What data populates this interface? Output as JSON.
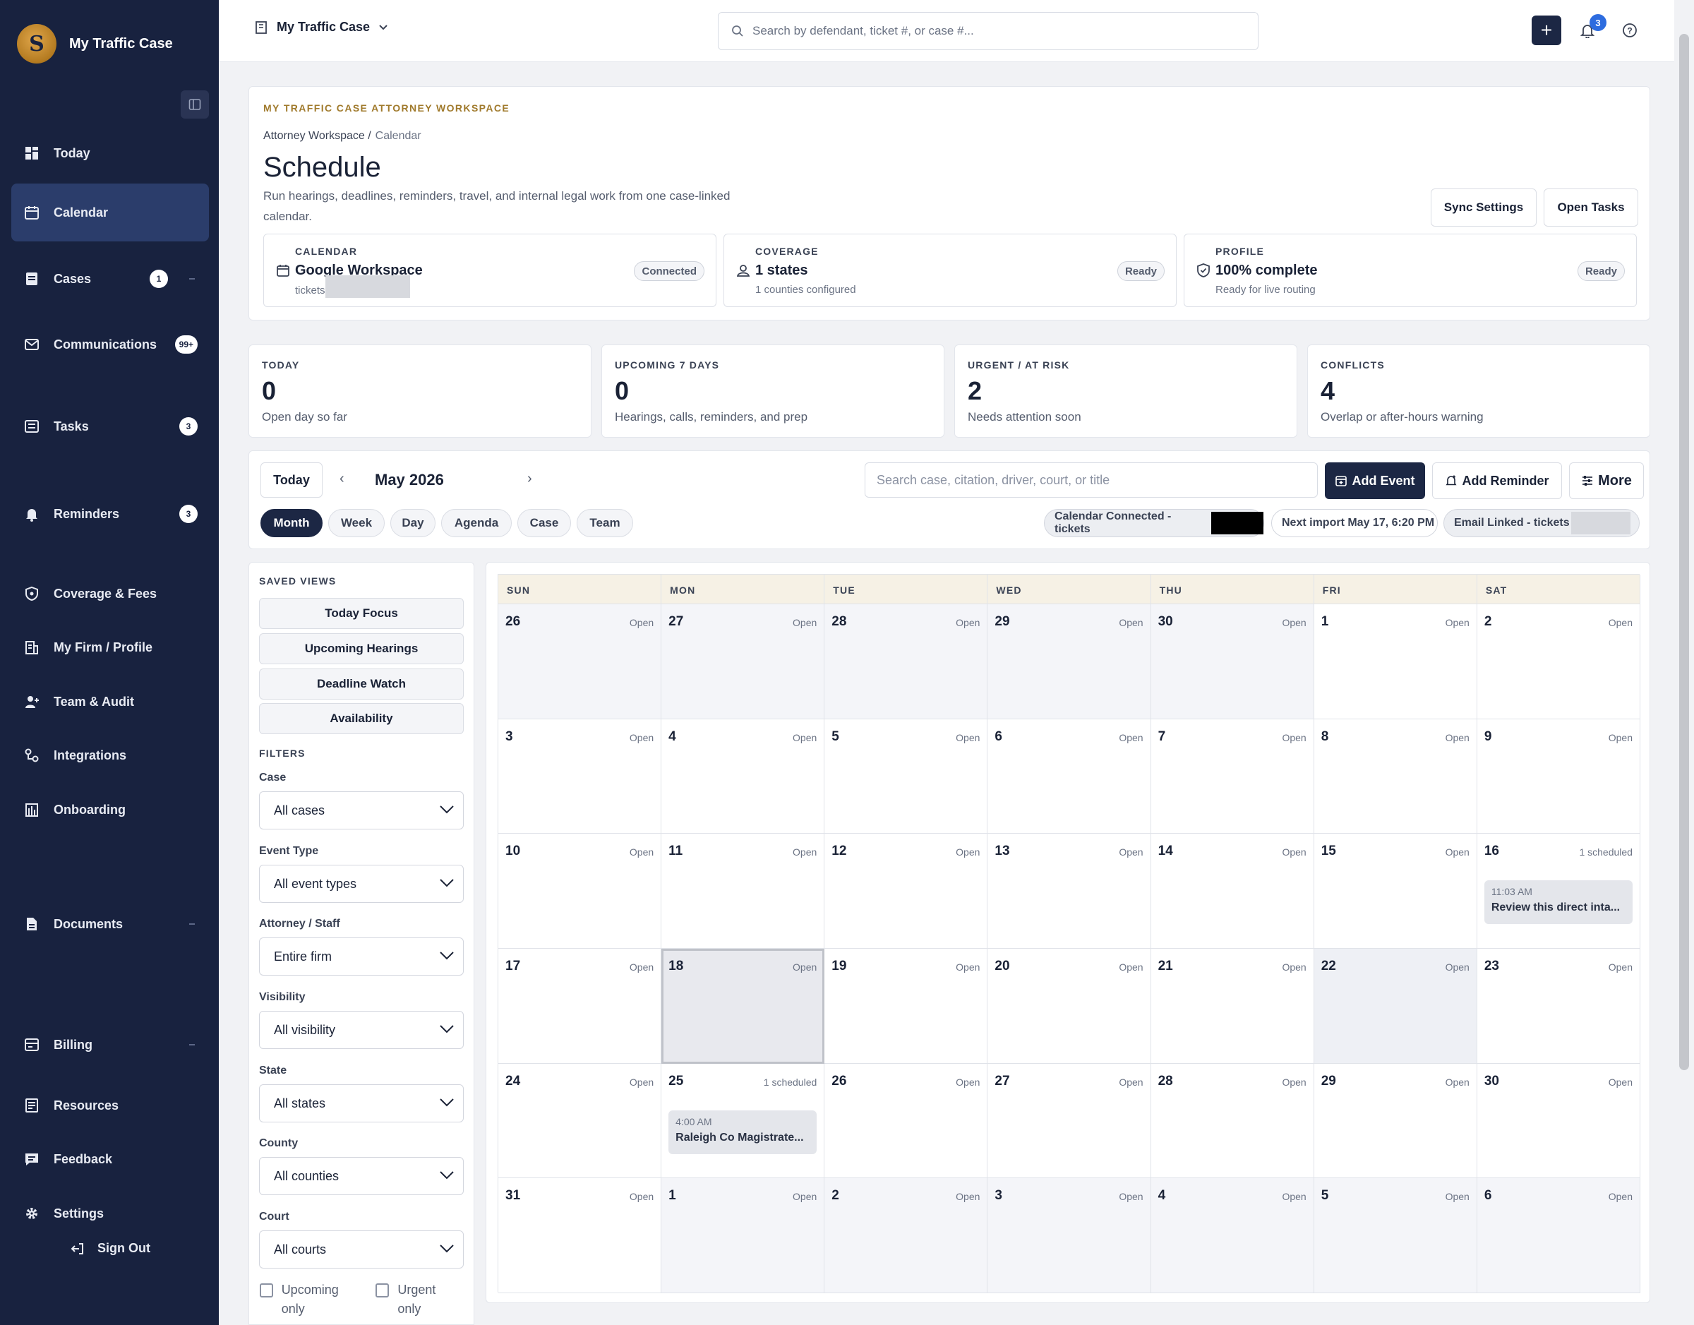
{
  "app": {
    "name": "My Traffic Case"
  },
  "sidebar": {
    "items": [
      {
        "label": "Today",
        "icon": "dashboard-icon",
        "badge": ""
      },
      {
        "label": "Calendar",
        "icon": "calendar-icon",
        "badge": "",
        "active": true
      },
      {
        "label": "Cases",
        "icon": "cases-icon",
        "badge": "1"
      },
      {
        "label": "Communications",
        "icon": "mail-icon",
        "badge": "99+"
      },
      {
        "label": "Tasks",
        "icon": "tasks-icon",
        "badge": "3"
      },
      {
        "label": "Reminders",
        "icon": "bell-icon",
        "badge": "3"
      },
      {
        "label": "Coverage & Fees",
        "icon": "shield-icon",
        "badge": ""
      },
      {
        "label": "My Firm / Profile",
        "icon": "building-icon",
        "badge": ""
      },
      {
        "label": "Team & Audit",
        "icon": "user-plus-icon",
        "badge": ""
      },
      {
        "label": "Integrations",
        "icon": "integrations-icon",
        "badge": ""
      },
      {
        "label": "Onboarding",
        "icon": "onboarding-icon",
        "badge": ""
      },
      {
        "label": "Documents",
        "icon": "document-icon",
        "badge": ""
      },
      {
        "label": "Billing",
        "icon": "billing-icon",
        "badge": ""
      },
      {
        "label": "Resources",
        "icon": "resources-icon",
        "badge": ""
      },
      {
        "label": "Feedback",
        "icon": "feedback-icon",
        "badge": ""
      },
      {
        "label": "Settings",
        "icon": "gear-icon",
        "badge": ""
      }
    ],
    "sign_out": "Sign Out"
  },
  "topbar": {
    "workspace": "My Traffic Case",
    "search_placeholder": "Search by defendant, ticket #, or case #...",
    "notifications_count": "3"
  },
  "header": {
    "eyebrow": "MY TRAFFIC CASE ATTORNEY WORKSPACE",
    "breadcrumb": [
      "Attorney Workspace /",
      "Calendar"
    ],
    "title": "Schedule",
    "subtitle": "Run hearings, deadlines, reminders, travel, and internal legal work from one case-linked calendar.",
    "buttons": {
      "sync": "Sync Settings",
      "tasks": "Open Tasks"
    },
    "status_cards": [
      {
        "label": "CALENDAR",
        "value": "Google Workspace",
        "sub": "tickets",
        "pill": "Connected",
        "icon": "calendar-icon"
      },
      {
        "label": "COVERAGE",
        "value": "1 states",
        "sub": "1 counties configured",
        "pill": "Ready",
        "icon": "user-location-icon"
      },
      {
        "label": "PROFILE",
        "value": "100% complete",
        "sub": "Ready for live routing",
        "pill": "Ready",
        "icon": "shield-check-icon"
      }
    ]
  },
  "stats": [
    {
      "label": "TODAY",
      "value": "0",
      "sub": "Open day so far"
    },
    {
      "label": "UPCOMING 7 DAYS",
      "value": "0",
      "sub": "Hearings, calls, reminders, and prep"
    },
    {
      "label": "URGENT / AT RISK",
      "value": "2",
      "sub": "Needs attention soon"
    },
    {
      "label": "CONFLICTS",
      "value": "4",
      "sub": "Overlap or after-hours warning"
    }
  ],
  "toolbar": {
    "today": "Today",
    "prev": "‹",
    "month": "May 2026",
    "next": "›",
    "search_placeholder": "Search case, citation, driver, court, or title",
    "add_event": "Add Event",
    "add_reminder": "Add Reminder",
    "more": "More",
    "views": [
      "Month",
      "Week",
      "Day",
      "Agenda",
      "Case",
      "Team"
    ],
    "active_view": "Month",
    "calendar_connected": "Calendar Connected - tickets",
    "next_import": "Next import May 17, 6:20 PM",
    "email_linked": "Email Linked - tickets"
  },
  "filters": {
    "saved_views_label": "SAVED VIEWS",
    "saved_views": [
      "Today Focus",
      "Upcoming Hearings",
      "Deadline Watch",
      "Availability"
    ],
    "filters_label": "FILTERS",
    "fields": [
      {
        "label": "Case",
        "value": "All cases"
      },
      {
        "label": "Event Type",
        "value": "All event types"
      },
      {
        "label": "Attorney / Staff",
        "value": "Entire firm"
      },
      {
        "label": "Visibility",
        "value": "All visibility"
      },
      {
        "label": "State",
        "value": "All states"
      },
      {
        "label": "County",
        "value": "All counties"
      },
      {
        "label": "Court",
        "value": "All courts"
      }
    ],
    "checks": [
      "Upcoming only",
      "Urgent only"
    ]
  },
  "calendar": {
    "weekdays": [
      "SUN",
      "MON",
      "TUE",
      "WED",
      "THU",
      "FRI",
      "SAT"
    ],
    "weeks": [
      [
        {
          "d": "26",
          "s": "Open",
          "m": "other"
        },
        {
          "d": "27",
          "s": "Open",
          "m": "other"
        },
        {
          "d": "28",
          "s": "Open",
          "m": "other"
        },
        {
          "d": "29",
          "s": "Open",
          "m": "other"
        },
        {
          "d": "30",
          "s": "Open",
          "m": "other"
        },
        {
          "d": "1",
          "s": "Open",
          "m": "cur"
        },
        {
          "d": "2",
          "s": "Open",
          "m": "cur"
        }
      ],
      [
        {
          "d": "3",
          "s": "Open",
          "m": "cur"
        },
        {
          "d": "4",
          "s": "Open",
          "m": "cur"
        },
        {
          "d": "5",
          "s": "Open",
          "m": "cur"
        },
        {
          "d": "6",
          "s": "Open",
          "m": "cur"
        },
        {
          "d": "7",
          "s": "Open",
          "m": "cur"
        },
        {
          "d": "8",
          "s": "Open",
          "m": "cur"
        },
        {
          "d": "9",
          "s": "Open",
          "m": "cur"
        }
      ],
      [
        {
          "d": "10",
          "s": "Open",
          "m": "cur"
        },
        {
          "d": "11",
          "s": "Open",
          "m": "cur"
        },
        {
          "d": "12",
          "s": "Open",
          "m": "cur"
        },
        {
          "d": "13",
          "s": "Open",
          "m": "cur"
        },
        {
          "d": "14",
          "s": "Open",
          "m": "cur"
        },
        {
          "d": "15",
          "s": "Open",
          "m": "cur"
        },
        {
          "d": "16",
          "s": "1 scheduled",
          "m": "cur",
          "event": {
            "time": "11:03 AM",
            "title": "Review this direct inta..."
          }
        }
      ],
      [
        {
          "d": "17",
          "s": "Open",
          "m": "cur"
        },
        {
          "d": "18",
          "s": "Open",
          "m": "today"
        },
        {
          "d": "19",
          "s": "Open",
          "m": "cur"
        },
        {
          "d": "20",
          "s": "Open",
          "m": "cur"
        },
        {
          "d": "21",
          "s": "Open",
          "m": "cur"
        },
        {
          "d": "22",
          "s": "Open",
          "m": "alt"
        },
        {
          "d": "23",
          "s": "Open",
          "m": "cur"
        }
      ],
      [
        {
          "d": "24",
          "s": "Open",
          "m": "cur"
        },
        {
          "d": "25",
          "s": "1 scheduled",
          "m": "cur",
          "event": {
            "time": "4:00 AM",
            "title": "Raleigh Co Magistrate..."
          }
        },
        {
          "d": "26",
          "s": "Open",
          "m": "cur"
        },
        {
          "d": "27",
          "s": "Open",
          "m": "cur"
        },
        {
          "d": "28",
          "s": "Open",
          "m": "cur"
        },
        {
          "d": "29",
          "s": "Open",
          "m": "cur"
        },
        {
          "d": "30",
          "s": "Open",
          "m": "cur"
        }
      ],
      [
        {
          "d": "31",
          "s": "Open",
          "m": "cur"
        },
        {
          "d": "1",
          "s": "Open",
          "m": "other"
        },
        {
          "d": "2",
          "s": "Open",
          "m": "other"
        },
        {
          "d": "3",
          "s": "Open",
          "m": "other"
        },
        {
          "d": "4",
          "s": "Open",
          "m": "other"
        },
        {
          "d": "5",
          "s": "Open",
          "m": "other"
        },
        {
          "d": "6",
          "s": "Open",
          "m": "other"
        }
      ]
    ]
  },
  "colors": {
    "sidebar": "#18223f",
    "active": "#2b3d6b",
    "accent_gold": "#a07a2c",
    "primary_button": "#1c2744"
  }
}
